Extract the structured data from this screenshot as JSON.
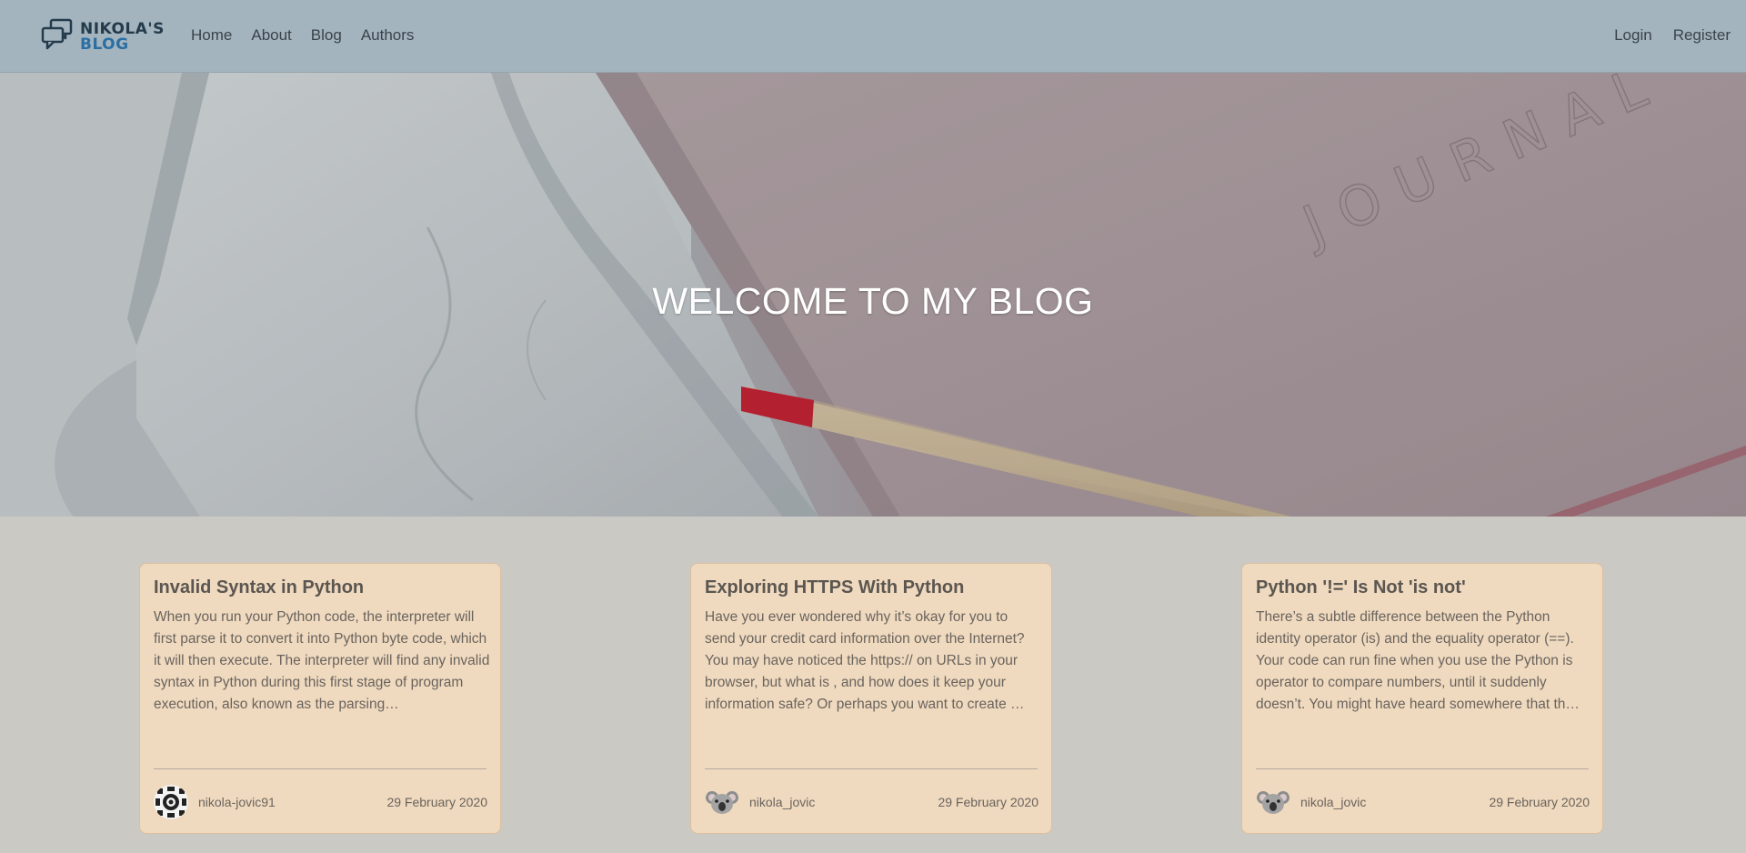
{
  "colors": {
    "navbar_bg": "#a4b4be",
    "page_bg": "#cbc9c4",
    "card_bg": "#efd9bf",
    "logo_dark": "#243b4c",
    "logo_blue": "#2a6fa3"
  },
  "navbar": {
    "logo": {
      "line1": "NIKOLA'S",
      "line2": "BLOG",
      "icon": "speech-bubbles-icon"
    },
    "links": [
      "Home",
      "About",
      "Blog",
      "Authors"
    ],
    "auth": {
      "login": "Login",
      "register": "Register"
    }
  },
  "hero": {
    "title": "WELCOME TO MY BLOG",
    "image_text": "JOURNAL"
  },
  "posts": [
    {
      "title": "Invalid Syntax in Python",
      "excerpt": "When you run your Python code, the interpreter will first parse it to convert it into Python byte code, which it will then execute. The interpreter will find any invalid syntax in Python during this first stage of program execution, also known as the parsing…",
      "author": "nikola-jovic91",
      "avatar": "geometric-avatar-icon",
      "date": "29 February 2020"
    },
    {
      "title": "Exploring HTTPS With Python",
      "excerpt": "Have you ever wondered why it’s okay for you to send your credit card information over the Internet? You may have noticed the https:// on URLs in your browser, but what is , and how does it keep your information safe? Or perhaps you want to create …",
      "author": "nikola_jovic",
      "avatar": "koala-avatar-icon",
      "date": "29 February 2020"
    },
    {
      "title": "Python '!=' Is Not 'is not'",
      "excerpt": "There’s a subtle difference between the Python identity operator (is) and the equality operator (==). Your code can run fine when you use the Python is operator to compare numbers, until it suddenly doesn’t. You might have heard somewhere that th…",
      "author": "nikola_jovic",
      "avatar": "koala-avatar-icon",
      "date": "29 February 2020"
    }
  ]
}
